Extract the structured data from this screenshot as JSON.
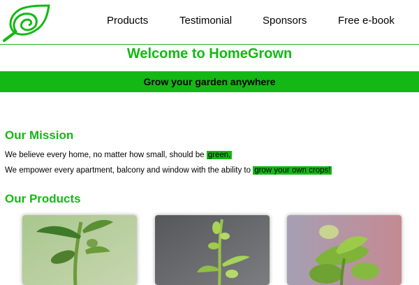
{
  "nav": {
    "items": [
      {
        "label": "Products"
      },
      {
        "label": "Testimonial"
      },
      {
        "label": "Sponsors"
      },
      {
        "label": "Free e-book"
      }
    ]
  },
  "welcome": "Welcome to HomeGrown",
  "banner": "Grow your garden anywhere",
  "mission": {
    "heading": "Our Mission",
    "line1_text": "We believe every home, no matter how small, should be ",
    "line1_highlight": "green.",
    "line2_text": "We empower every apartment, balcony and window with the ability to ",
    "line2_highlight": "grow your own crops!"
  },
  "products": {
    "heading": "Our Products",
    "cards": [
      {
        "image": "plant-sprout-photo-1"
      },
      {
        "image": "plant-seedling-photo-2"
      },
      {
        "image": "basil-plant-photo-3"
      }
    ]
  },
  "colors": {
    "brand_green": "#14b814",
    "text": "#000000"
  }
}
